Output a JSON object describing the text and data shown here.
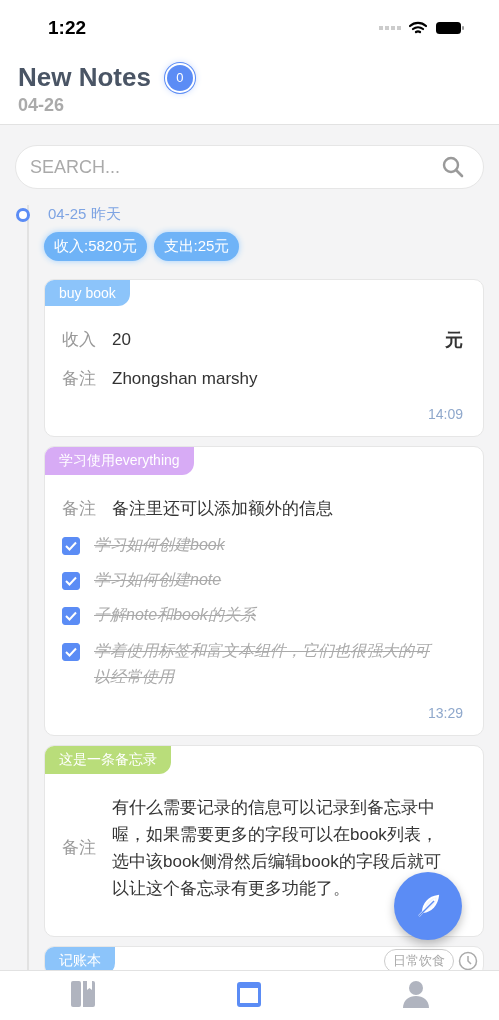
{
  "status_bar": {
    "time": "1:22"
  },
  "header": {
    "title": "New Notes",
    "count": "0",
    "date": "04-26"
  },
  "search": {
    "placeholder": "SEARCH..."
  },
  "day": {
    "date": "04-25 昨天",
    "summary": [
      {
        "text": "收入:5820元"
      },
      {
        "text": "支出:25元"
      }
    ]
  },
  "notes": [
    {
      "tag": "buy book",
      "color": "#8cc4fa",
      "rows": [
        {
          "kind": "field",
          "label": "收入",
          "value": "20",
          "unit": "元"
        },
        {
          "kind": "field",
          "label": "备注",
          "value": "Zhongshan marshy"
        }
      ],
      "time": "14:09"
    },
    {
      "tag": "学习使用everything",
      "color": "#d7abf5",
      "rows": [
        {
          "kind": "field",
          "label": "备注",
          "value": "备注里还可以添加额外的信息"
        },
        {
          "kind": "check",
          "text": "学习如何创建book",
          "checked": true
        },
        {
          "kind": "check",
          "text": "学习如何创建note",
          "checked": true
        },
        {
          "kind": "check",
          "text": "子解note和book的关系",
          "checked": true
        },
        {
          "kind": "check",
          "text": "学着使用标签和富文本组件，它们也很强大的可以经常使用",
          "checked": true
        }
      ],
      "time": "13:29"
    },
    {
      "tag": "这是一条备忘录",
      "color": "#b9dd7a",
      "rows": [
        {
          "kind": "field",
          "label": "备注",
          "value": "有什么需要记录的信息可以记录到备忘录中喔，如果需要更多的字段可以在book列表，选中该book侧滑然后编辑book的字段后就可以让这个备忘录有更多功能了。"
        }
      ]
    },
    {
      "tag": "记账本",
      "color": "#8cc4fa",
      "chip": "日常饮食"
    }
  ],
  "tabs": [
    {
      "kind": "book",
      "selected": false
    },
    {
      "kind": "calendar",
      "selected": true
    },
    {
      "kind": "person",
      "selected": false
    }
  ]
}
